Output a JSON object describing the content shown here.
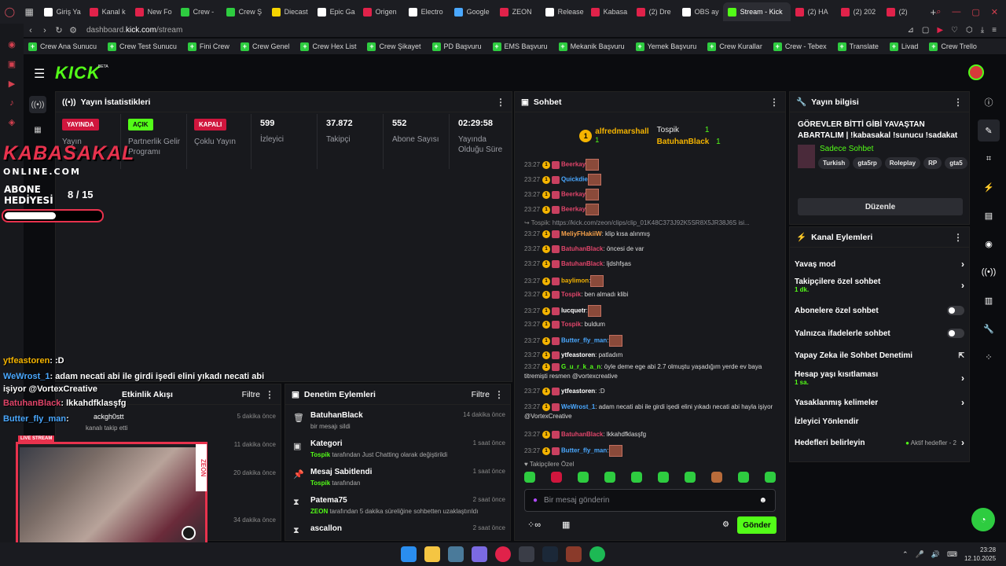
{
  "browser": {
    "tabs": [
      {
        "label": "Giriş Ya",
        "color": "#ffffff"
      },
      {
        "label": "Kanal k",
        "color": "#e0224a"
      },
      {
        "label": "New Fo",
        "color": "#e0224a"
      },
      {
        "label": "Crew -",
        "color": "#2ecc40"
      },
      {
        "label": "Crew Ş",
        "color": "#2ecc40"
      },
      {
        "label": "Diecast",
        "color": "#f5d400"
      },
      {
        "label": "Epic Ga",
        "color": "#ffffff"
      },
      {
        "label": "Origen",
        "color": "#e0224a"
      },
      {
        "label": "Electro",
        "color": "#ffffff"
      },
      {
        "label": "Google",
        "color": "#4aa8ff"
      },
      {
        "label": "ZEON",
        "color": "#e0224a"
      },
      {
        "label": "Release",
        "color": "#ffffff"
      },
      {
        "label": "Kabasa",
        "color": "#e0224a"
      },
      {
        "label": "(2) Dre",
        "color": "#e0224a"
      },
      {
        "label": "OBS ay",
        "color": "#ffffff"
      },
      {
        "label": "Stream - Kick",
        "color": "#53fc18",
        "active": true
      },
      {
        "label": "(2) HA",
        "color": "#e0224a"
      },
      {
        "label": "(2) 202",
        "color": "#e0224a"
      },
      {
        "label": "(2)",
        "color": "#e0224a"
      }
    ],
    "url_prefix": "dashboard.",
    "url_host": "kick.com",
    "url_path": "/stream",
    "bookmarks": [
      "Crew Ana Sunucu",
      "Crew Test Sunucu",
      "Fini Crew",
      "Crew Genel",
      "Crew Hex List",
      "Crew Şikayet",
      "PD Başvuru",
      "EMS Başvuru",
      "Mekanik Başvuru",
      "Yemek Başvuru",
      "Crew Kurallar",
      "Crew - Tebex",
      "Translate",
      "Livad",
      "Crew Trello"
    ]
  },
  "kick": {
    "logo": "KICK",
    "logo_badge": "BETA"
  },
  "stats": {
    "title": "Yayın İstatistikleri",
    "live_badge": "YAYINDA",
    "live_label": "Yayın",
    "partner_badge": "AÇIK",
    "partner_label": "Partnerlik Gelir Programı",
    "multi_badge": "KAPALI",
    "multi_label": "Çoklu Yayın",
    "viewers": "599",
    "viewers_label": "İzleyici",
    "followers": "37.872",
    "followers_label": "Takipçi",
    "subs": "552",
    "subs_label": "Abone Sayısı",
    "uptime": "02:29:58",
    "uptime_label": "Yayında Olduğu Süre"
  },
  "chat": {
    "title": "Sohbet",
    "pinned": {
      "user1": "alfredmarshall",
      "count1": "1",
      "user2": "Tospik",
      "count2": "1",
      "user3": "BatuhanBlack",
      "count3": "1"
    },
    "messages": [
      {
        "time": "23:27",
        "user": "Beerkay",
        "cls": "un-r",
        "text": ""
      },
      {
        "time": "23:27",
        "user": "Quickdie",
        "cls": "un-b",
        "text": ""
      },
      {
        "time": "23:27",
        "user": "Beerkay",
        "cls": "un-r",
        "text": ""
      },
      {
        "time": "23:27",
        "user": "Beerkay",
        "cls": "un-r",
        "text": ""
      },
      {
        "time": "",
        "user": "Tospik:",
        "cls": "",
        "text": "https://kick.com/zeon/clips/clip_01K48C373J92K5SR8X5JR38J6S isi..."
      },
      {
        "time": "23:27",
        "user": "MeliyFHakiiW",
        "cls": "un-o",
        "text": ": klip kısa alınmış"
      },
      {
        "time": "23:27",
        "user": "BatuhanBlack",
        "cls": "un-r",
        "text": ": öncesi de var"
      },
      {
        "time": "23:27",
        "user": "BatuhanBlack",
        "cls": "un-r",
        "text": ": ljdshfşas"
      },
      {
        "time": "23:27",
        "user": "baylimon",
        "cls": "un-y",
        "text": ":"
      },
      {
        "time": "23:27",
        "user": "Tospik",
        "cls": "un-r",
        "text": ": ben almadı klibi"
      },
      {
        "time": "23:27",
        "user": "lucquetr",
        "cls": "un-w",
        "text": ":"
      },
      {
        "time": "23:27",
        "user": "Tospik",
        "cls": "un-r",
        "text": ": buldum"
      },
      {
        "time": "23:27",
        "user": "Butter_fly_man",
        "cls": "un-b",
        "text": ":"
      },
      {
        "time": "23:27",
        "user": "ytfeastoren",
        "cls": "un-w",
        "text": ": patladım"
      },
      {
        "time": "23:27",
        "user": "G_u_r_k_a_n",
        "cls": "un-g",
        "text": ": öyle deme ege abi 2.7 olmuştu yaşadığım yerde ev baya titremişti resmen @vortexcreative"
      },
      {
        "time": "23:27",
        "user": "ytfeastoren",
        "cls": "un-w",
        "text": ": :D"
      },
      {
        "time": "23:27",
        "user": "WeWrost_1",
        "cls": "un-b",
        "text": ": adam necati abi ile girdi işedi elini yıkadı necati abi hayla işiyor @VortexCreative"
      },
      {
        "time": "23:27",
        "user": "BatuhanBlack",
        "cls": "un-r",
        "text": ": lkkahdfklasşfg"
      },
      {
        "time": "23:27",
        "user": "Butter_fly_man",
        "cls": "un-b",
        "text": ":"
      }
    ],
    "followers_only": "Takipçilere Özel",
    "input_placeholder": "Bir mesaj gönderin",
    "send": "Gönder"
  },
  "info": {
    "title": "Yayın bilgisi",
    "stream_title": "GÖREVLER BİTTİ GİBİ YAVAŞTAN ABARTALIM | !kabasakal !sunucu !sadakat !livad !sonvideo",
    "category": "Sadece Sohbet",
    "tags": [
      "Turkish",
      "gta5rp",
      "Roleplay",
      "RP",
      "gta5"
    ],
    "edit": "Düzenle"
  },
  "actions": {
    "title": "Kanal Eylemleri",
    "slow": "Yavaş mod",
    "followers_chat": "Takipçilere özel sohbet",
    "followers_sub": "1 dk.",
    "subs_chat": "Abonelere özel sohbet",
    "emote_chat": "Yalnızca ifadelerle sohbet",
    "ai": "Yapay Zeka ile Sohbet Denetimi",
    "age": "Hesap yaşı kısıtlaması",
    "age_sub": "1 sa.",
    "banned": "Yasaklanmış kelimeler",
    "host": "İzleyici Yönlendir",
    "goals": "Hedefleri belirleyin",
    "goals_sub": "Aktif hedefler - 2"
  },
  "activity": {
    "title": "Etkinlik Akışı",
    "filter": "Filtre",
    "items": [
      {
        "name": "ackgh0stt",
        "desc": "kanalı takip etti",
        "time": "5 dakika önce"
      },
      {
        "name": "",
        "desc": "",
        "time": "11 dakika önce"
      },
      {
        "name": "",
        "desc": "hlik süresi - 5 ay!",
        "time": "20 dakika önce"
      },
      {
        "name": "",
        "desc": "",
        "time": "34 dakika önce"
      }
    ]
  },
  "mod": {
    "title": "Denetim Eylemleri",
    "filter": "Filtre",
    "items": [
      {
        "title": "BatuhanBlack",
        "user": "",
        "desc": "bir mesajı sildi",
        "time": "14 dakika önce",
        "icon": "🗑"
      },
      {
        "title": "Kategori",
        "user": "Tospik",
        "desc": " tarafından Just Chatting olarak değiştirildi",
        "time": "1 saat önce",
        "icon": "▣"
      },
      {
        "title": "Mesaj Sabitlendi",
        "user": "Tospik",
        "desc": " tarafından",
        "time": "1 saat önce",
        "icon": "📌"
      },
      {
        "title": "Patema75",
        "user": "ZEON",
        "desc": " tarafından 5 dakika süreliğine sohbetten uzaklaştırıldı",
        "time": "2 saat önce",
        "icon": "⧗"
      },
      {
        "title": "ascallon",
        "user": "",
        "desc": "",
        "time": "2 saat önce",
        "icon": "⧗"
      }
    ]
  },
  "overlay": {
    "logo": "KABASAKAL",
    "logo2": "ONLINE.COM",
    "abone": "ABONE",
    "hediyesi": "HEDİYESİ",
    "count": "8 / 15",
    "progress": 0.53,
    "chat": [
      {
        "user": "ytfeastoren",
        "cls": "un-y",
        "text": ": :D"
      },
      {
        "user": "WeWrost_1",
        "cls": "un-b",
        "text": ": adam necati abi ile girdi işedi elini yıkadı necati abi"
      },
      {
        "user": "",
        "cls": "",
        "text": "işiyor @VortexCreative"
      },
      {
        "user": "BatuhanBlack",
        "cls": "un-r",
        "text": ": lkkahdfklasşfg"
      },
      {
        "user": "Butter_fly_man",
        "cls": "un-b",
        "text": ":"
      }
    ],
    "live_tag": "LIVE STREAM",
    "zeon": "ZEON"
  },
  "taskbar": {
    "time": "23:28",
    "date": "12.10.2025"
  }
}
